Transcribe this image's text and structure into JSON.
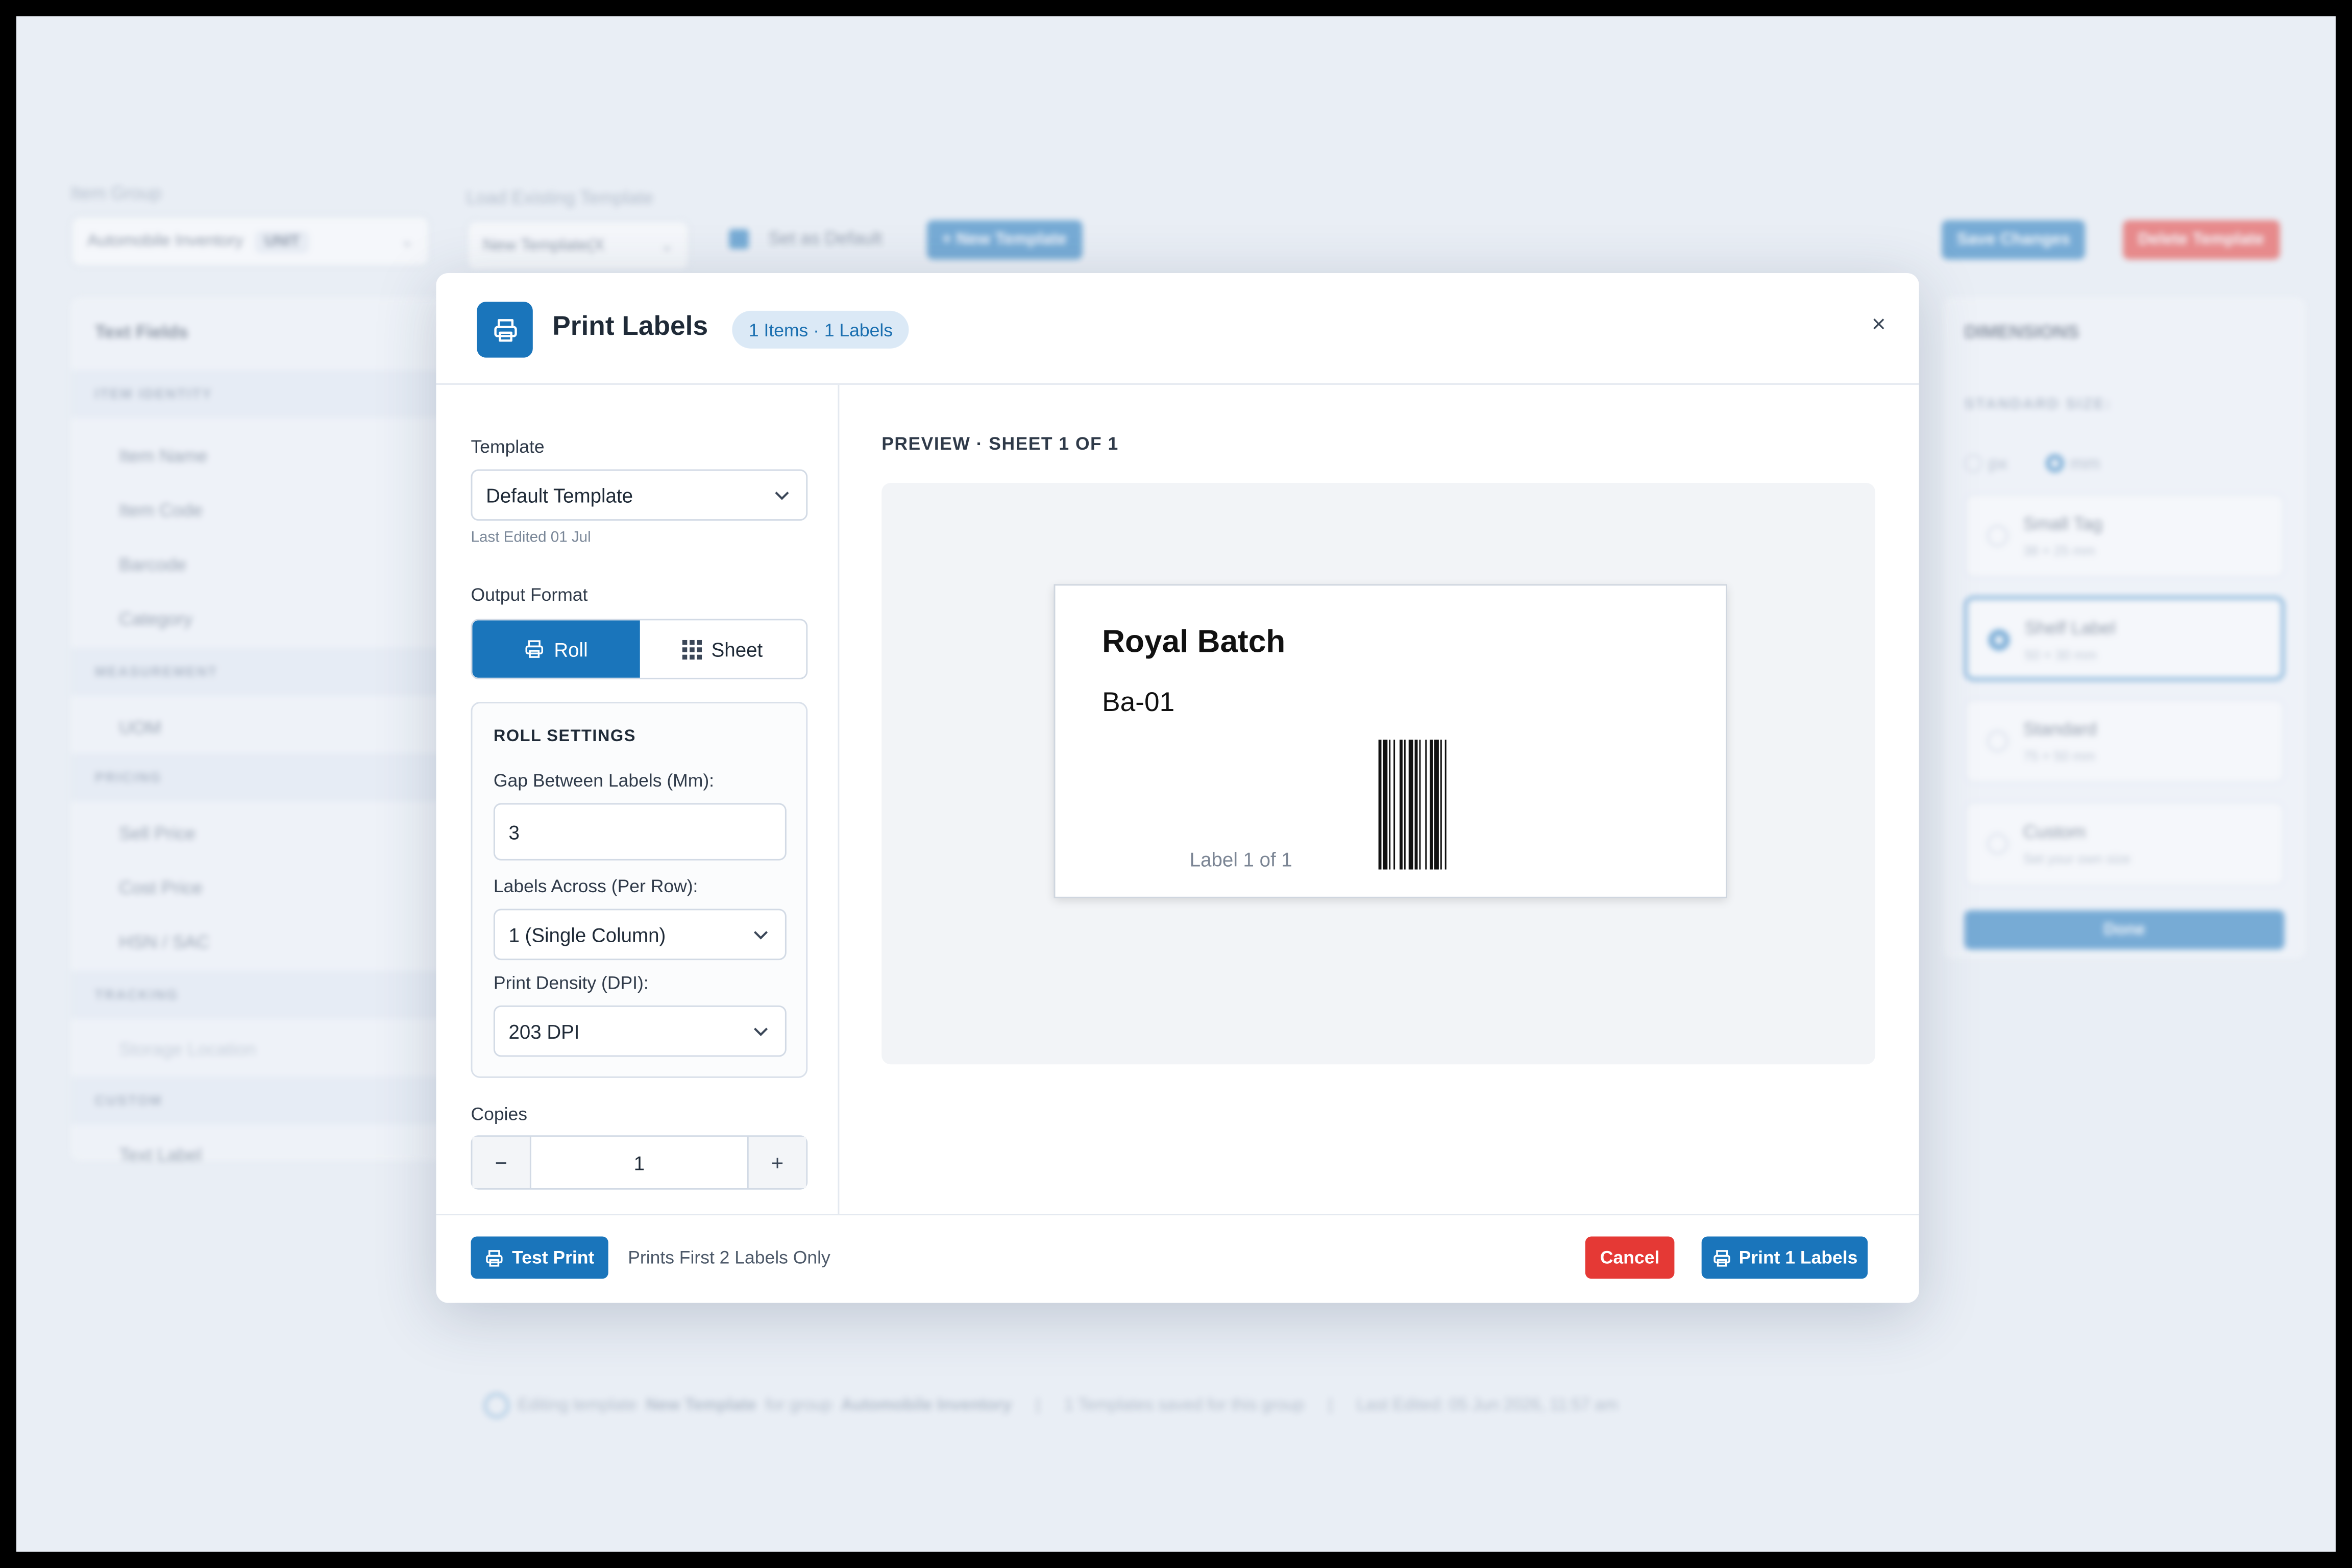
{
  "background": {
    "item_group_label": "Item Group",
    "item_group_value": "Automobile Inventory",
    "item_group_unit": "UNIT",
    "load_template_label": "Load Existing Template",
    "load_template_value": "New Template(X",
    "set_default_label": "Set as Default",
    "new_template_button": "+ New Template",
    "save_changes_button": "Save Changes",
    "delete_template_button": "Delete Template",
    "text_fields_title": "Text Fields",
    "sections": [
      {
        "title": "ITEM IDENTITY",
        "fields": [
          "Item Name",
          "Item Code",
          "Barcode",
          "Category"
        ]
      },
      {
        "title": "MEASUREMENT",
        "fields": [
          "UOM"
        ]
      },
      {
        "title": "PRICING",
        "fields": [
          "Sell Price",
          "Cost Price",
          "HSN / SAC"
        ]
      },
      {
        "title": "TRACKING",
        "fields": [
          "Storage Location"
        ]
      },
      {
        "title": "CUSTOM",
        "fields": [
          "Text Label"
        ]
      }
    ],
    "dimensions_title": "DIMENSIONS",
    "standard_size_label": "STANDARD SIZE:",
    "unit_px": "px",
    "unit_mm": "mm",
    "sizes": [
      {
        "name": "Small Tag",
        "size": "38 × 25 mm"
      },
      {
        "name": "Shelf Label",
        "size": "50 × 30 mm"
      },
      {
        "name": "Standard",
        "size": "75 × 50 mm"
      },
      {
        "name": "Custom",
        "size": "Set your own size"
      }
    ],
    "done_button": "Done",
    "footer": {
      "prefix": "Editing template",
      "template": "New Template",
      "mid": "for group",
      "group": "Automobile Inventory",
      "saved": "1 Templates saved for this group",
      "edited": "Last Edited: 05 Jun 2026, 11:57 am"
    }
  },
  "modal": {
    "title": "Print Labels",
    "badge": "1 Items · 1 Labels",
    "template_label": "Template",
    "template_value": "Default Template",
    "last_edited": "Last Edited 01 Jul",
    "output_format_label": "Output Format",
    "format_roll": "Roll",
    "format_sheet": "Sheet",
    "roll_settings_title": "ROLL SETTINGS",
    "gap_label": "Gap Between Labels (Mm):",
    "gap_value": "3",
    "across_label": "Labels Across (Per Row):",
    "across_value": "1 (Single Column)",
    "density_label": "Print Density (DPI):",
    "density_value": "203 DPI",
    "copies_label": "Copies",
    "copies_value": "1",
    "copies_minus": "−",
    "copies_plus": "+",
    "preview_title": "PREVIEW · SHEET 1 OF 1",
    "label": {
      "name": "Royal Batch",
      "code": "Ba-01",
      "count": "Label 1 of 1"
    },
    "test_print": "Test Print",
    "test_note": "Prints First 2 Labels Only",
    "cancel": "Cancel",
    "print": "Print 1 Labels",
    "close": "×"
  },
  "colors": {
    "primary": "#1a75bb",
    "danger": "#e53935",
    "badge_bg": "#dbe9f6"
  }
}
